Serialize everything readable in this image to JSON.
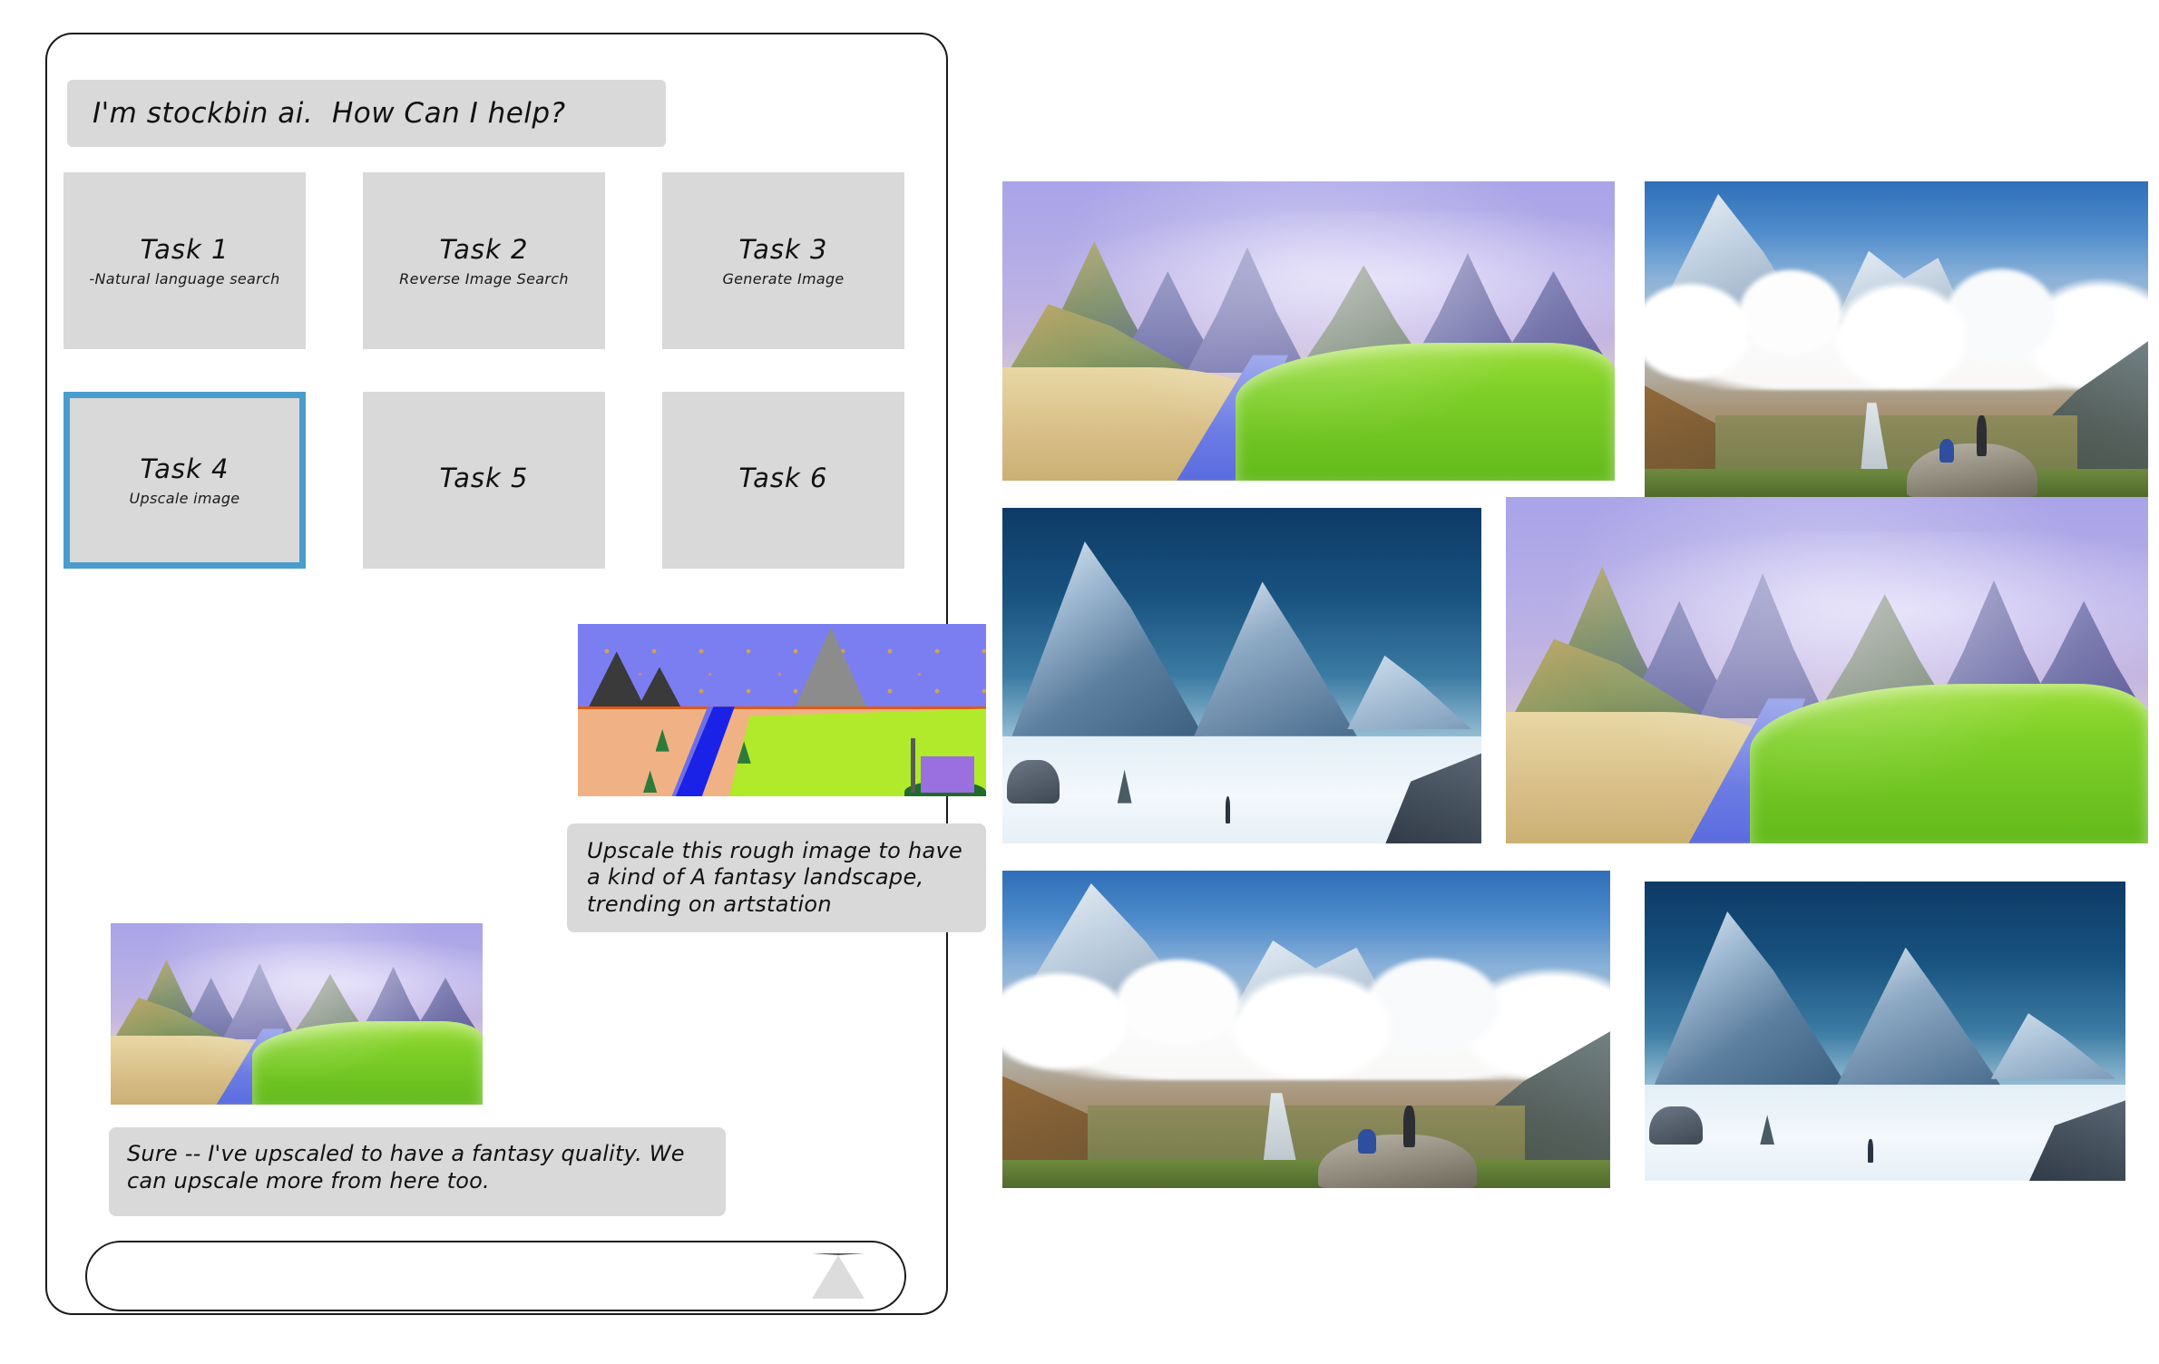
{
  "app": {
    "greeting": "I'm stockbin ai.  How Can I help?"
  },
  "tasks": [
    {
      "title": "Task 1",
      "subtitle": "-Natural language search",
      "selected": false
    },
    {
      "title": "Task 2",
      "subtitle": "Reverse Image Search",
      "selected": false
    },
    {
      "title": "Task 3",
      "subtitle": "Generate Image",
      "selected": false
    },
    {
      "title": "Task 4",
      "subtitle": "Upscale image",
      "selected": true
    },
    {
      "title": "Task 5",
      "subtitle": "",
      "selected": false
    },
    {
      "title": "Task 6",
      "subtitle": "",
      "selected": false
    }
  ],
  "conversation": {
    "user_attachment_alt": "rough sketch of a fantasy landscape with mountains, river, green field and castle",
    "user_message": "Upscale this rough image to have a kind of A fantasy landscape, trending on artstation",
    "assistant_attachment_alt": "upscaled fantasy landscape with misty purple peaks, golden sand, blue river and bright green grass",
    "assistant_message": "Sure -- I've upscaled to have a fantasy quality.  We can upscale more from here too."
  },
  "composer": {
    "value": "",
    "placeholder": "",
    "send_label": "send"
  },
  "gallery": [
    {
      "alt": "fantasy landscape with misty purple peaks, blue river and green grass",
      "kind": "fantasy"
    },
    {
      "alt": "himalayan valley photo with two trekkers on a rock above a sea of clouds",
      "kind": "himalaya"
    },
    {
      "alt": "blue snow mountain illustration with a lone figure on a snowfield",
      "kind": "snowy"
    },
    {
      "alt": "fantasy landscape with misty purple peaks, blue river and green grass",
      "kind": "fantasy"
    },
    {
      "alt": "himalayan valley photo with two trekkers on a rock above a sea of clouds",
      "kind": "himalaya"
    },
    {
      "alt": "blue snow mountain illustration with a lone figure on a snowfield",
      "kind": "snowy"
    }
  ],
  "colors": {
    "selection_blue": "#4a9ccd",
    "bubble_gray": "#d9d9d9",
    "window_border": "#1a1a1a",
    "send_triangle": "#dcdcdc"
  }
}
